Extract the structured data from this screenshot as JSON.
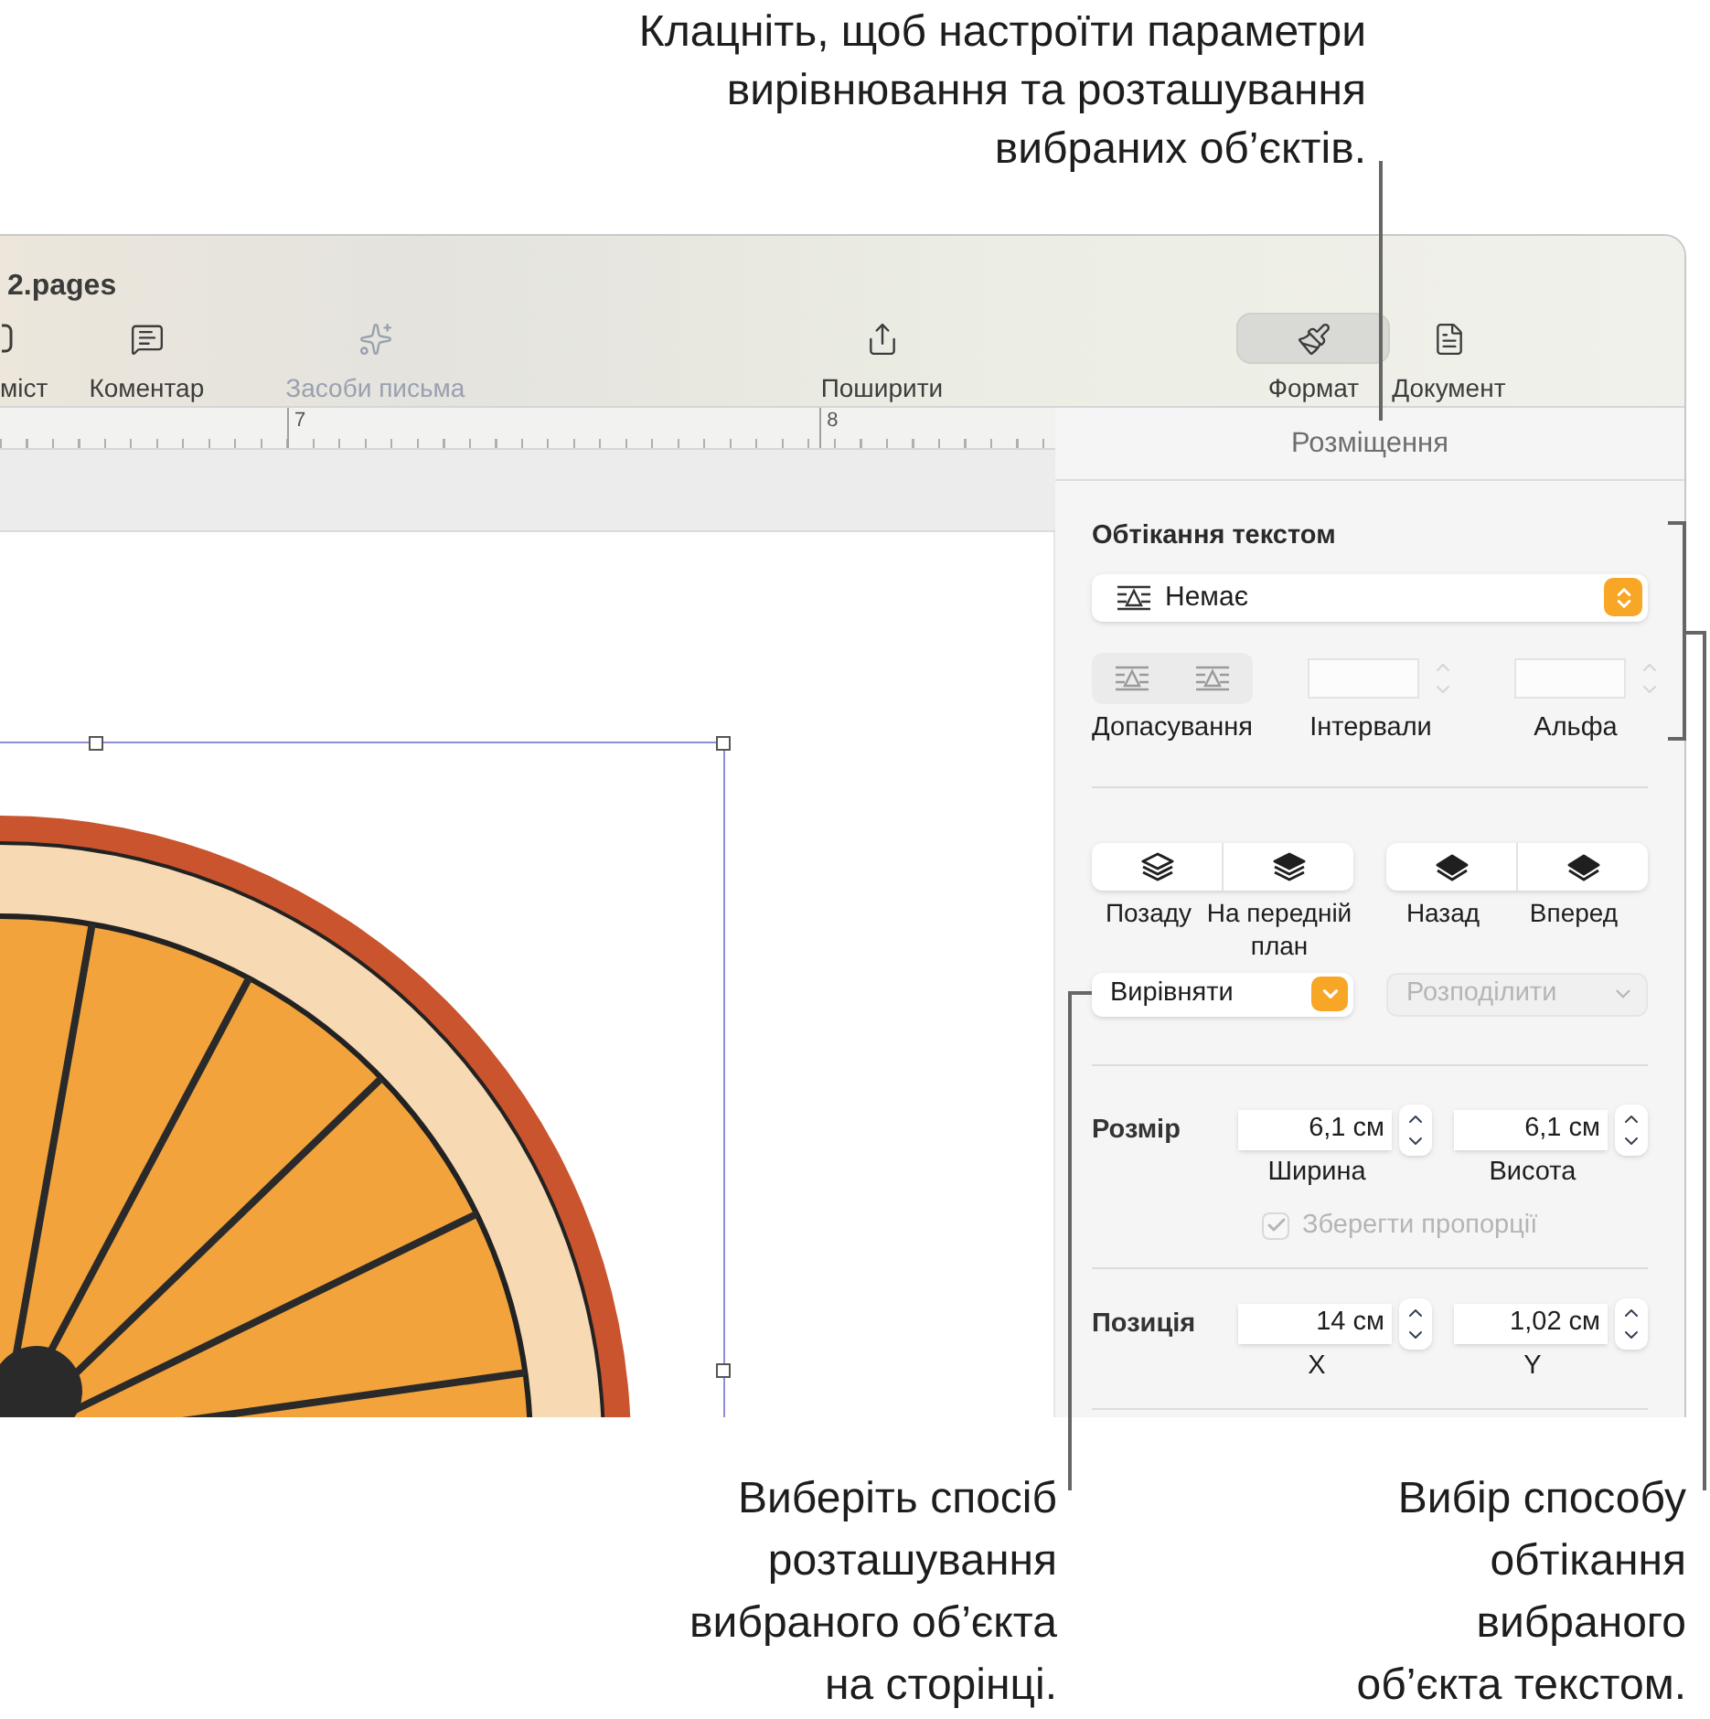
{
  "top_callout": "Клацніть, щоб настроїти параметри\nвирівнювання та розташування\nвибраних об’єктів.",
  "window": {
    "title": "2.pages"
  },
  "toolbar": [
    {
      "kind": "content",
      "label": "міст",
      "disabled": false,
      "selected": false
    },
    {
      "kind": "comment",
      "label": "Коментар",
      "disabled": false,
      "selected": false
    },
    {
      "kind": "writing_tools",
      "label": "Засоби письма",
      "disabled": true,
      "selected": false
    },
    {
      "kind": "share",
      "label": "Поширити",
      "disabled": false,
      "selected": false
    },
    {
      "kind": "format",
      "label": "Формат",
      "disabled": false,
      "selected": true
    },
    {
      "kind": "document",
      "label": "Документ",
      "disabled": false,
      "selected": false
    }
  ],
  "ruler": {
    "labels": [
      "7",
      "8"
    ]
  },
  "sidebar": {
    "tabs": [
      {
        "label": "Розміщення",
        "selected": true
      }
    ],
    "text_wrap": {
      "title": "Обтікання текстом",
      "value": "Немає",
      "fit_label": "Допасування",
      "fit_disabled": true,
      "spacing_label": "Інтервали",
      "alpha_label": "Альфа"
    },
    "arrange": [
      {
        "kind": "back",
        "label": "Позаду"
      },
      {
        "kind": "front",
        "label": "На передній план"
      },
      {
        "kind": "backward",
        "label": "Назад"
      },
      {
        "kind": "forward",
        "label": "Вперед"
      }
    ],
    "align": {
      "label": "Вирівняти",
      "disabled": false
    },
    "distribute": {
      "label": "Розподілити",
      "disabled": true
    },
    "size": {
      "label": "Розмір",
      "width": "6,1 см",
      "width_label": "Ширина",
      "height": "6,1 см",
      "height_label": "Висота",
      "constrain": {
        "label": "Зберегти пропорції",
        "checked": true,
        "disabled": true
      }
    },
    "position": {
      "label": "Позиція",
      "x": "14 см",
      "x_label": "X",
      "y": "1,02 см",
      "y_label": "Y"
    }
  },
  "callouts": [
    {
      "text": "Виберіть спосіб\nрозташування\nвибраного об’єкта\nна сторінці."
    },
    {
      "text": "Вибір способу\nобтікання\nвибраного\nоб’єкта текстом."
    }
  ]
}
